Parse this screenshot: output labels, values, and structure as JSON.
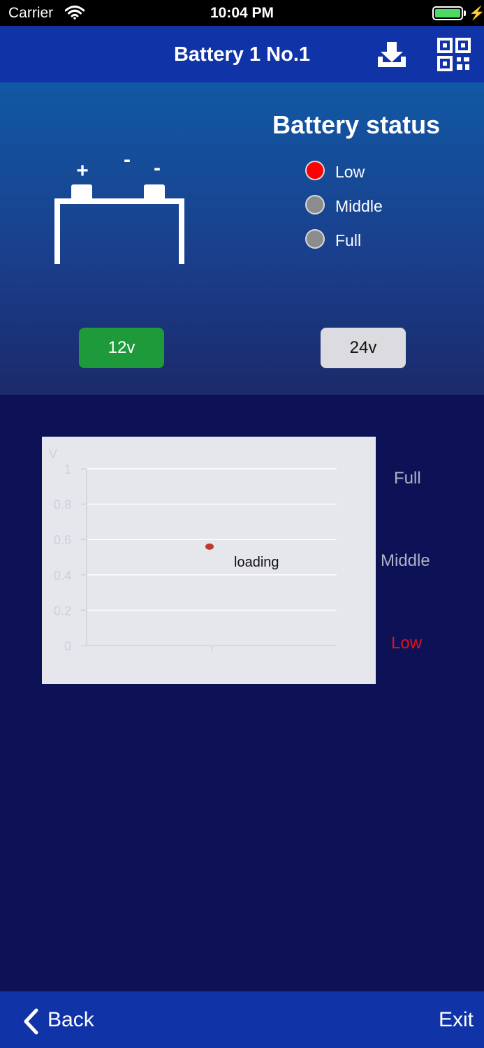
{
  "status_bar": {
    "carrier": "Carrier",
    "time": "10:04 PM"
  },
  "nav": {
    "title": "Battery 1 No.1",
    "download_icon": "download-icon",
    "qr_icon": "qr-code-icon"
  },
  "battery_graphic": {
    "plus": "+",
    "minus1": "-",
    "minus2": "-"
  },
  "battery_status": {
    "title": "Battery status",
    "levels": [
      {
        "label": "Low",
        "color": "#ff0000",
        "active": true
      },
      {
        "label": "Middle",
        "color": "#8c8c8c",
        "active": false
      },
      {
        "label": "Full",
        "color": "#8c8c8c",
        "active": false
      }
    ]
  },
  "voltage_buttons": {
    "v12": "12v",
    "v24": "24v",
    "selected": "12v"
  },
  "chart_data": {
    "type": "scatter",
    "ylabel": "V",
    "ylim": [
      0,
      1
    ],
    "yticks": [
      "0",
      "0.2",
      "0.4",
      "0.6",
      "0.8",
      "1"
    ],
    "points": [
      {
        "x": 0.5,
        "y": 0.56
      }
    ],
    "annotation": "loading",
    "point_color": "#c0392b"
  },
  "side_levels": {
    "full": "Full",
    "middle": "Middle",
    "low": "Low"
  },
  "bottom_bar": {
    "back": "Back",
    "exit": "Exit"
  }
}
